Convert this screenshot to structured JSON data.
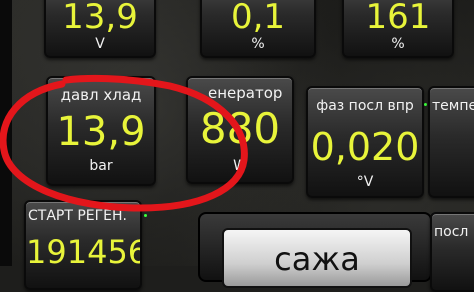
{
  "top_row": [
    {
      "value": "13,9",
      "unit": "V"
    },
    {
      "value": "0,1",
      "unit": "%"
    },
    {
      "value": "161",
      "unit": "%"
    }
  ],
  "middle_row": [
    {
      "label": "давл хлад",
      "value": "13,9",
      "unit": "bar"
    },
    {
      "label": "енератор",
      "value": "880",
      "unit": "W"
    },
    {
      "label": "фаз посл впр",
      "value": "0,020",
      "unit": "°V"
    },
    {
      "label": "темпер",
      "value": "",
      "unit": ""
    }
  ],
  "bottom_row": [
    {
      "label": "СТАРТ РЕГЕН.",
      "value": "191456"
    },
    {
      "label": "посл",
      "value": ""
    }
  ],
  "soot_button": {
    "label": "сажа"
  },
  "colors": {
    "value_yellow": "#e8f43a",
    "annotation_red": "#e3161b",
    "indicator_green": "#3cff3c"
  }
}
